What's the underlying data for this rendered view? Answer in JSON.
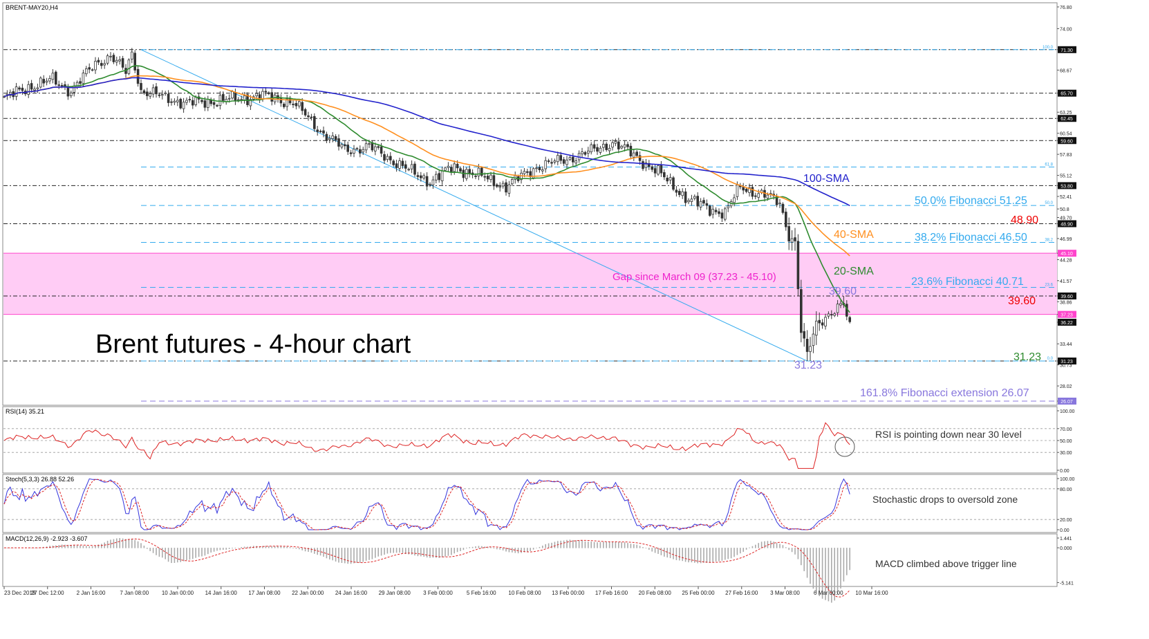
{
  "window": {
    "symbol_label": "BRENT-MAY20,H4",
    "headline": "Brent futures - 4-hour chart"
  },
  "colors": {
    "candle": "#333333",
    "sma20": "#2e8b2e",
    "sma40": "#ff9020",
    "sma100": "#2222cc",
    "fib": "#33aaee",
    "gap_fill": "#ffccf5",
    "gap_line": "#ff44cc",
    "red_text": "#ee0000",
    "ext": "#8877dd",
    "rsi": "#dd2222",
    "stoch_main": "#3333dd",
    "stoch_signal": "#dd2222"
  },
  "chart_data": [
    {
      "type": "candlestick",
      "title": "Brent futures - 4-hour chart",
      "ylim": [
        26.07,
        76.8
      ],
      "price_ticks": [
        "76.80",
        "74.00",
        "71.30",
        "68.67",
        "65.70",
        "63.25",
        "62.45",
        "60.54",
        "59.60",
        "57.83",
        "55.12",
        "53.80",
        "52.41",
        "50.8",
        "49.70",
        "48.90",
        "46.99",
        "45.10",
        "44.28",
        "41.57",
        "39.60",
        "38.86",
        "37.23",
        "36.22",
        "33.44",
        "31.23",
        "30.73",
        "28.02",
        "26.07"
      ],
      "time_labels": [
        "23 Dec 2019",
        "27 Dec 12:00",
        "2 Jan 16:00",
        "7 Jan 08:00",
        "10 Jan 00:00",
        "14 Jan 16:00",
        "17 Jan 08:00",
        "22 Jan 00:00",
        "24 Jan 16:00",
        "29 Jan 08:00",
        "3 Feb 00:00",
        "5 Feb 16:00",
        "10 Feb 08:00",
        "13 Feb 00:00",
        "17 Feb 16:00",
        "20 Feb 08:00",
        "25 Feb 00:00",
        "27 Feb 16:00",
        "3 Mar 08:00",
        "6 Mar 00:00",
        "10 Mar 16:00"
      ],
      "close_anchors": [
        {
          "t": 0,
          "v": 65.0
        },
        {
          "t": 8,
          "v": 66.5
        },
        {
          "t": 16,
          "v": 67.4
        },
        {
          "t": 22,
          "v": 66.0
        },
        {
          "t": 30,
          "v": 69.5
        },
        {
          "t": 35,
          "v": 70.5
        },
        {
          "t": 40,
          "v": 68.4
        },
        {
          "t": 42,
          "v": 70.8
        },
        {
          "t": 45,
          "v": 66.0
        },
        {
          "t": 60,
          "v": 64.4
        },
        {
          "t": 75,
          "v": 64.9
        },
        {
          "t": 85,
          "v": 65.4
        },
        {
          "t": 95,
          "v": 64.5
        },
        {
          "t": 105,
          "v": 60.5
        },
        {
          "t": 112,
          "v": 58.4
        },
        {
          "t": 120,
          "v": 58.8
        },
        {
          "t": 128,
          "v": 57.0
        },
        {
          "t": 135,
          "v": 55.3
        },
        {
          "t": 140,
          "v": 54.4
        },
        {
          "t": 148,
          "v": 56.2
        },
        {
          "t": 158,
          "v": 54.8
        },
        {
          "t": 165,
          "v": 53.7
        },
        {
          "t": 175,
          "v": 56.2
        },
        {
          "t": 185,
          "v": 57.2
        },
        {
          "t": 195,
          "v": 58.5
        },
        {
          "t": 200,
          "v": 59.4
        },
        {
          "t": 208,
          "v": 57.5
        },
        {
          "t": 215,
          "v": 55.5
        },
        {
          "t": 225,
          "v": 52.0
        },
        {
          "t": 232,
          "v": 50.8
        },
        {
          "t": 237,
          "v": 50.3
        },
        {
          "t": 242,
          "v": 53.6
        },
        {
          "t": 250,
          "v": 52.6
        },
        {
          "t": 255,
          "v": 51.5
        },
        {
          "t": 258,
          "v": 47.5
        },
        {
          "t": 260,
          "v": 46.5
        },
        {
          "t": 262,
          "v": 35.0
        },
        {
          "t": 264,
          "v": 31.9
        },
        {
          "t": 267,
          "v": 36.0
        },
        {
          "t": 270,
          "v": 37.0
        },
        {
          "t": 274,
          "v": 37.9
        },
        {
          "t": 276,
          "v": 38.4
        },
        {
          "t": 278,
          "v": 35.6
        }
      ],
      "series": [
        {
          "name": "20-SMA"
        },
        {
          "name": "40-SMA"
        },
        {
          "name": "100-SMA"
        }
      ],
      "fibonacci": {
        "retracement_levels": [
          {
            "ratio": "100.0",
            "value": 71.3
          },
          {
            "ratio": "61.8",
            "value": 56.2
          },
          {
            "ratio": "50.0",
            "value": 51.25
          },
          {
            "ratio": "38.2",
            "value": 46.5
          },
          {
            "ratio": "23.6",
            "value": 40.71
          },
          {
            "ratio": "0.0",
            "value": 31.23
          }
        ],
        "labels": [
          "50.0% Fibonacci 51.25",
          "38.2% Fibonacci 46.50",
          "23.6% Fibonacci 40.71"
        ],
        "extension_label": "161.8% Fibonacci extension 26.07",
        "extension_value": 26.07,
        "trend_from": {
          "t": 45,
          "v": 71.3
        },
        "trend_to": {
          "t": 264,
          "v": 31.23
        }
      },
      "horizontal_levels": [
        71.3,
        65.7,
        62.45,
        59.6,
        53.8,
        48.9,
        39.6,
        31.23
      ],
      "price_tags": [
        {
          "value": 71.3,
          "text": "71.30"
        },
        {
          "value": 65.7,
          "text": "65.70"
        },
        {
          "value": 62.45,
          "text": "62.45"
        },
        {
          "value": 59.6,
          "text": "59.60"
        },
        {
          "value": 53.8,
          "text": "53.80"
        },
        {
          "value": 48.9,
          "text": "48.90"
        },
        {
          "value": 45.1,
          "text": "45.10",
          "kind": "gap"
        },
        {
          "value": 39.6,
          "text": "39.60"
        },
        {
          "value": 37.23,
          "text": "37.23",
          "kind": "gap"
        },
        {
          "value": 36.22,
          "text": "36.22"
        },
        {
          "value": 31.23,
          "text": "31.23"
        },
        {
          "value": 26.07,
          "text": "26.07",
          "kind": "ext"
        }
      ],
      "gap": {
        "low": 37.23,
        "high": 45.1,
        "label": "Gap since March 09 (37.23 - 45.10)"
      },
      "annotations": {
        "sma100": "100-SMA",
        "sma40": "40-SMA",
        "sma20": "20-SMA",
        "level_48_90": "48.90",
        "level_39_60_red": "39.60",
        "level_39_60_high": "39.60",
        "level_31_23_green": "31.23",
        "level_31_23_low": "31.23"
      }
    },
    {
      "type": "line",
      "title": "RSI(14) 35.21",
      "ylim": [
        0,
        100
      ],
      "ticks": [
        "100.00",
        "70.00",
        "50.00",
        "30.00",
        "0.00"
      ],
      "annotation": "RSI is pointing down near 30 level"
    },
    {
      "type": "line",
      "title": "Stoch(5,3,3) 26.88 52.26",
      "ylim": [
        0,
        100
      ],
      "ticks": [
        "100.00",
        "80.00",
        "20.00",
        "0.00"
      ],
      "annotation": "Stochastic drops to oversold zone"
    },
    {
      "type": "bar",
      "title": "MACD(12,26,9) -2.923 -3.607",
      "ylim": [
        -5.1,
        1.441
      ],
      "ticks": [
        "1.441",
        "0.000",
        "-5.141"
      ],
      "annotation": "MACD climbed above trigger line"
    }
  ]
}
